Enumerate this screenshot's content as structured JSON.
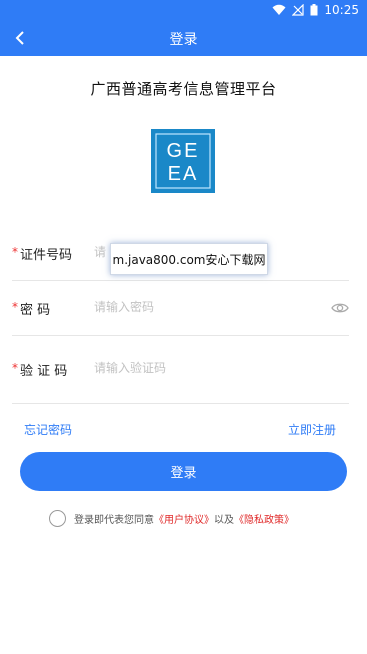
{
  "status_bar": {
    "time": "10:25"
  },
  "nav": {
    "title": "登录"
  },
  "app_title": "广西普通高考信息管理平台",
  "logo": {
    "text_top": "GE",
    "text_bottom": "EA"
  },
  "fields": [
    {
      "label": "证件号码",
      "placeholder": "请"
    },
    {
      "label": "密 码",
      "placeholder": "请输入密码"
    },
    {
      "label": "验 证 码",
      "placeholder": "请输入验证码"
    }
  ],
  "required_mark": "*",
  "watermark": "m.java800.com安心下载网",
  "links": {
    "forgot": "忘记密码",
    "register": "立即注册"
  },
  "login_button": "登录",
  "agreement": {
    "prefix": "登录即代表您同意",
    "user_agreement": "《用户协议》",
    "and": "以及",
    "privacy": "《隐私政策》"
  },
  "colors": {
    "primary": "#2f7cf6",
    "required": "#e33333",
    "logo_bg": "#1a88c8"
  }
}
